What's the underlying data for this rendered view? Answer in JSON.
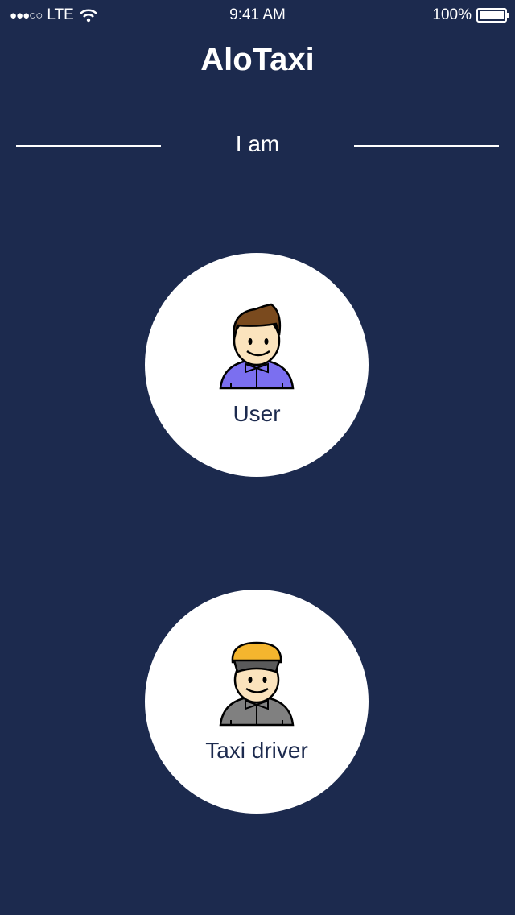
{
  "status_bar": {
    "signal": "●●●○○",
    "carrier": "LTE",
    "time": "9:41 AM",
    "battery": "100%"
  },
  "header": {
    "title": "AloTaxi"
  },
  "prompt": "I am",
  "options": [
    {
      "label": "User",
      "icon": "user-avatar-icon"
    },
    {
      "label": "Taxi driver",
      "icon": "taxi-driver-avatar-icon"
    }
  ],
  "colors": {
    "background": "#1c2a4e",
    "circle": "#ffffff"
  }
}
